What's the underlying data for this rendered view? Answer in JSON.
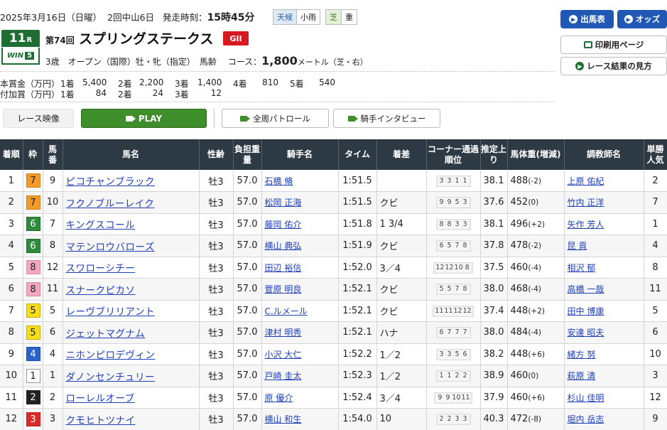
{
  "header": {
    "date": "2025年3月16日（日曜）",
    "meeting": "2回中山6日",
    "post_label": "発走時刻：",
    "post_time": "15時45分",
    "weather_label": "天候",
    "weather": "小雨",
    "track_label": "芝",
    "track_cond": "重"
  },
  "race": {
    "no": "11",
    "no_suffix": "R",
    "win5_text": "WIN",
    "win5_num": "5",
    "kai": "第74回",
    "name": "スプリングステークス",
    "grade": "GII",
    "conditions": "3歳　オープン（国際）牡・牝（指定）　馬齢",
    "course_label": "コース：",
    "distance": "1,800",
    "unit": "メートル（芝・右）"
  },
  "buttons": {
    "entries": "出馬表",
    "odds": "オッズ",
    "print": "印刷用ページ",
    "howto": "レース結果の見方"
  },
  "prize": {
    "main_label": "本賞金（万円）",
    "main": [
      {
        "pos": "1着",
        "val": "5,400"
      },
      {
        "pos": "2着",
        "val": "2,200"
      },
      {
        "pos": "3着",
        "val": "1,400"
      },
      {
        "pos": "4着",
        "val": "810"
      },
      {
        "pos": "5着",
        "val": "540"
      }
    ],
    "add_label": "付加賞（万円）",
    "add": [
      {
        "pos": "1着",
        "val": "84"
      },
      {
        "pos": "2着",
        "val": "24"
      },
      {
        "pos": "3着",
        "val": "12"
      }
    ]
  },
  "video": {
    "label": "レース映像",
    "play": "PLAY",
    "patrol": "全周パトロール",
    "interview": "騎手インタビュー"
  },
  "table": {
    "headers": [
      "着順",
      "枠",
      "馬番",
      "馬名",
      "性齢",
      "負担重量",
      "騎手名",
      "タイム",
      "着差",
      "コーナー通過順位",
      "推定上り",
      "馬体重(増減)",
      "調教師名",
      "単勝人気"
    ],
    "rows": [
      {
        "rank": "1",
        "waku": "7",
        "num": "9",
        "horse": "ピコチャンブラック",
        "sex": "牡3",
        "wt": "57.0",
        "jockey": "石橋 脩",
        "time": "1:51.5",
        "margin": "",
        "corner": [
          "3",
          "3",
          "1",
          "1"
        ],
        "agari": "38.1",
        "body": "488",
        "diff": "(-2)",
        "trainer": "上原 佑紀",
        "pop": "2"
      },
      {
        "rank": "2",
        "waku": "7",
        "num": "10",
        "horse": "フクノブルーレイク",
        "sex": "牡3",
        "wt": "57.0",
        "jockey": "松岡 正海",
        "time": "1:51.5",
        "margin": "クビ",
        "corner": [
          "9",
          "9",
          "5",
          "3"
        ],
        "agari": "37.6",
        "body": "452",
        "diff": "(0)",
        "trainer": "竹内 正洋",
        "pop": "7"
      },
      {
        "rank": "3",
        "waku": "6",
        "num": "7",
        "horse": "キングスコール",
        "sex": "牡3",
        "wt": "57.0",
        "jockey": "藤岡 佑介",
        "time": "1:51.8",
        "margin": "1 3/4",
        "corner": [
          "8",
          "8",
          "3",
          "3"
        ],
        "agari": "38.1",
        "body": "496",
        "diff": "(+2)",
        "trainer": "矢作 芳人",
        "pop": "1"
      },
      {
        "rank": "4",
        "waku": "6",
        "num": "8",
        "horse": "マテンロウバローズ",
        "sex": "牡3",
        "wt": "57.0",
        "jockey": "横山 典弘",
        "time": "1:51.9",
        "margin": "クビ",
        "corner": [
          "6",
          "5",
          "7",
          "8"
        ],
        "agari": "37.8",
        "body": "478",
        "diff": "(-2)",
        "trainer": "昆 貢",
        "pop": "4"
      },
      {
        "rank": "5",
        "waku": "8",
        "num": "12",
        "horse": "スワローシチー",
        "sex": "牡3",
        "wt": "57.0",
        "jockey": "田辺 裕信",
        "time": "1:52.0",
        "margin": "3／4",
        "corner": [
          "12",
          "12",
          "10",
          "8"
        ],
        "agari": "37.5",
        "body": "460",
        "diff": "(-4)",
        "trainer": "相沢 郁",
        "pop": "8"
      },
      {
        "rank": "6",
        "waku": "8",
        "num": "11",
        "horse": "スナークピカソ",
        "sex": "牡3",
        "wt": "57.0",
        "jockey": "菅原 明良",
        "time": "1:52.1",
        "margin": "クビ",
        "corner": [
          "5",
          "5",
          "7",
          "8"
        ],
        "agari": "38.0",
        "body": "468",
        "diff": "(-4)",
        "trainer": "高橋 一哉",
        "pop": "11"
      },
      {
        "rank": "7",
        "waku": "5",
        "num": "5",
        "horse": "レーヴブリリアント",
        "sex": "牡3",
        "wt": "57.0",
        "jockey": "C.ルメール",
        "time": "1:52.1",
        "margin": "クビ",
        "corner": [
          "11",
          "11",
          "12",
          "12"
        ],
        "agari": "37.4",
        "body": "448",
        "diff": "(+2)",
        "trainer": "田中 博康",
        "pop": "5"
      },
      {
        "rank": "8",
        "waku": "5",
        "num": "6",
        "horse": "ジェットマグナム",
        "sex": "牡3",
        "wt": "57.0",
        "jockey": "津村 明秀",
        "time": "1:52.1",
        "margin": "ハナ",
        "corner": [
          "6",
          "7",
          "7",
          "7"
        ],
        "agari": "38.0",
        "body": "484",
        "diff": "(-4)",
        "trainer": "安達 昭夫",
        "pop": "6"
      },
      {
        "rank": "9",
        "waku": "4",
        "num": "4",
        "horse": "ニホンピロデヴィン",
        "sex": "牡3",
        "wt": "57.0",
        "jockey": "小沢 大仁",
        "time": "1:52.2",
        "margin": "1／2",
        "corner": [
          "3",
          "3",
          "5",
          "6"
        ],
        "agari": "38.2",
        "body": "448",
        "diff": "(+6)",
        "trainer": "緒方 努",
        "pop": "10"
      },
      {
        "rank": "10",
        "waku": "1",
        "num": "1",
        "horse": "ダノンセンチュリー",
        "sex": "牡3",
        "wt": "57.0",
        "jockey": "戸崎 圭太",
        "time": "1:52.3",
        "margin": "1／2",
        "corner": [
          "1",
          "1",
          "2",
          "2"
        ],
        "agari": "38.9",
        "body": "460",
        "diff": "(0)",
        "trainer": "萩原 清",
        "pop": "3"
      },
      {
        "rank": "11",
        "waku": "2",
        "num": "2",
        "horse": "ローレルオーブ",
        "sex": "牡3",
        "wt": "57.0",
        "jockey": "原 優介",
        "time": "1:52.4",
        "margin": "3／4",
        "corner": [
          "9",
          "9",
          "10",
          "11"
        ],
        "agari": "37.9",
        "body": "460",
        "diff": "(+6)",
        "trainer": "杉山 佳明",
        "pop": "12"
      },
      {
        "rank": "12",
        "waku": "3",
        "num": "3",
        "horse": "クモヒトツナイ",
        "sex": "牡3",
        "wt": "57.0",
        "jockey": "横山 和生",
        "time": "1:54.0",
        "margin": "10",
        "corner": [
          "2",
          "2",
          "3",
          "3"
        ],
        "agari": "40.3",
        "body": "472",
        "diff": "(-8)",
        "trainer": "堀内 岳志",
        "pop": "9"
      }
    ]
  }
}
